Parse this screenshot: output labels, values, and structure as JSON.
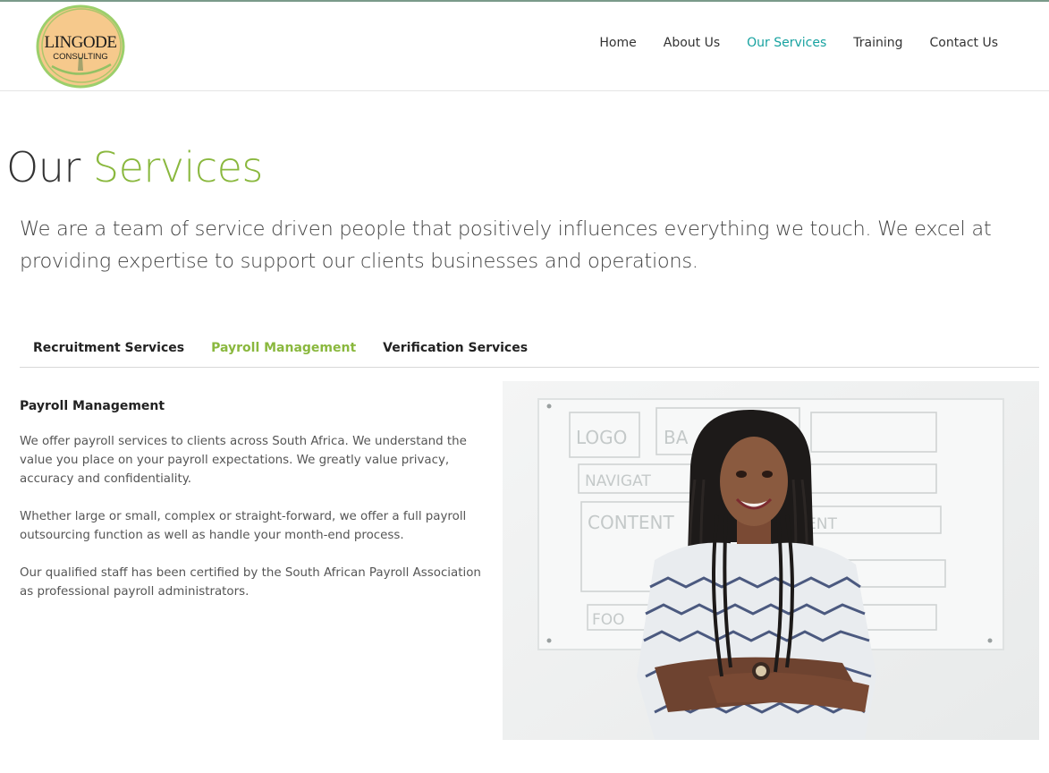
{
  "brand": {
    "name": "LINGODE",
    "sub": "CONSULTING"
  },
  "nav": {
    "items": [
      "Home",
      "About Us",
      "Our Services",
      "Training",
      "Contact Us"
    ],
    "active_index": 2
  },
  "page": {
    "title_part1": "Our",
    "title_part2": "Services",
    "intro": "We are a team of service driven people that positively influences everything we touch. We excel at providing expertise to support our clients businesses and operations."
  },
  "tabs": {
    "items": [
      "Recruitment Services",
      "Payroll Management",
      "Verification Services"
    ],
    "active_index": 1
  },
  "panel": {
    "heading": "Payroll Management",
    "paragraphs": [
      "We offer payroll services to clients across South Africa. We understand the value you place on your payroll expectations. We greatly value privacy, accuracy and confidentiality.",
      "Whether large or small, complex or straight-forward, we offer a full payroll outsourcing function as well as handle your month-end process.",
      "Our qualified staff has been certified by the South African Payroll Association as professional payroll administrators."
    ]
  },
  "whiteboard_text": [
    "LOGO",
    "BA",
    "NAVIGAT",
    "CONTENT",
    "ENT",
    "FOO"
  ],
  "colors": {
    "accent_green": "#8ab83e",
    "nav_active": "#17a2a0",
    "logo_circle": "#f6c98c",
    "logo_ring": "#9ccf6b"
  }
}
